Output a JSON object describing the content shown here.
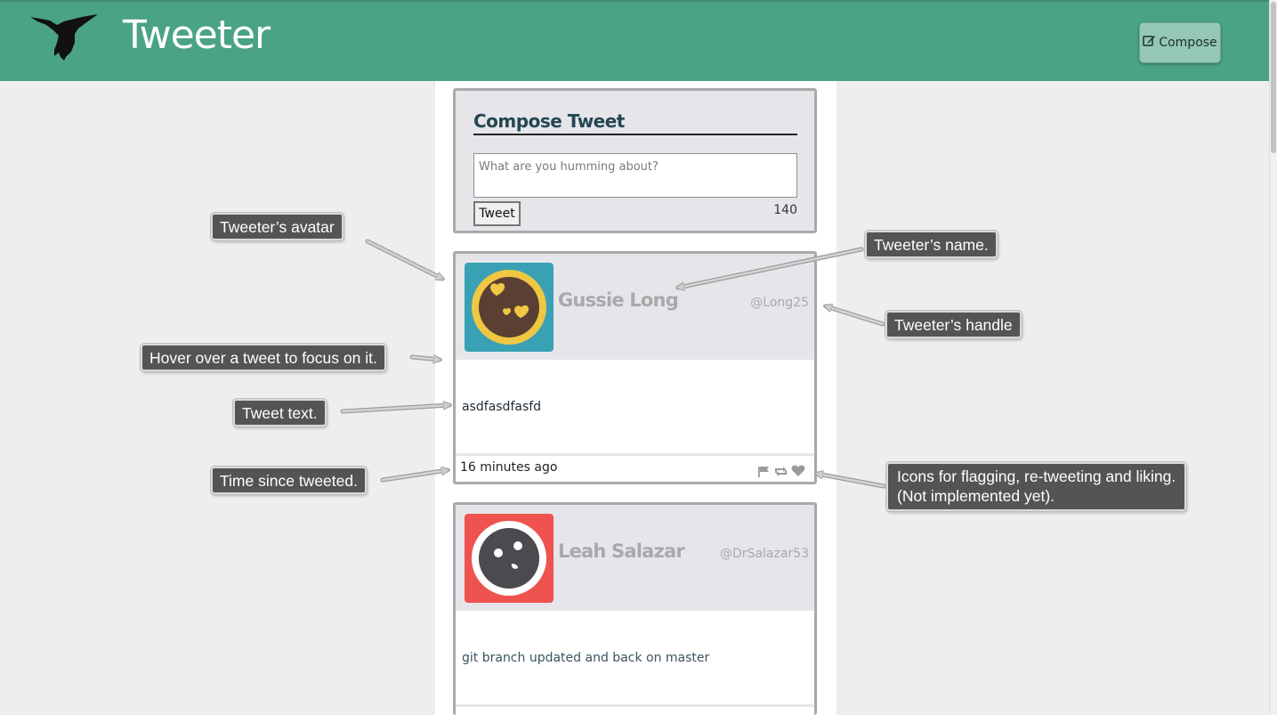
{
  "app": {
    "title": "Tweeter",
    "brand_color": "#4aa387",
    "compose_button": "Compose"
  },
  "compose": {
    "heading": "Compose Tweet",
    "placeholder": "What are you humming about?",
    "submit_label": "Tweet",
    "char_count": "140"
  },
  "tweets": [
    {
      "name": "Gussie Long",
      "handle": "@Long25",
      "text": "asdfasdfasfd",
      "time": "16 minutes ago",
      "avatar_bg": "#3aa1b5",
      "icons": [
        "flag-icon",
        "retweet-icon",
        "heart-icon"
      ]
    },
    {
      "name": "Leah Salazar",
      "handle": "@DrSalazar53",
      "text": "git branch updated and back on master",
      "avatar_bg": "#ee5350"
    }
  ],
  "annotations": {
    "avatar": "Tweeter’s avatar",
    "name": "Tweeter’s name.",
    "handle": "Tweeter’s handle",
    "hover": "Hover over a tweet to focus on it.",
    "text": "Tweet text.",
    "time": "Time since tweeted.",
    "icons_line1": "Icons for flagging, re-tweeting and liking.",
    "icons_line2": "(Not implemented yet)."
  }
}
